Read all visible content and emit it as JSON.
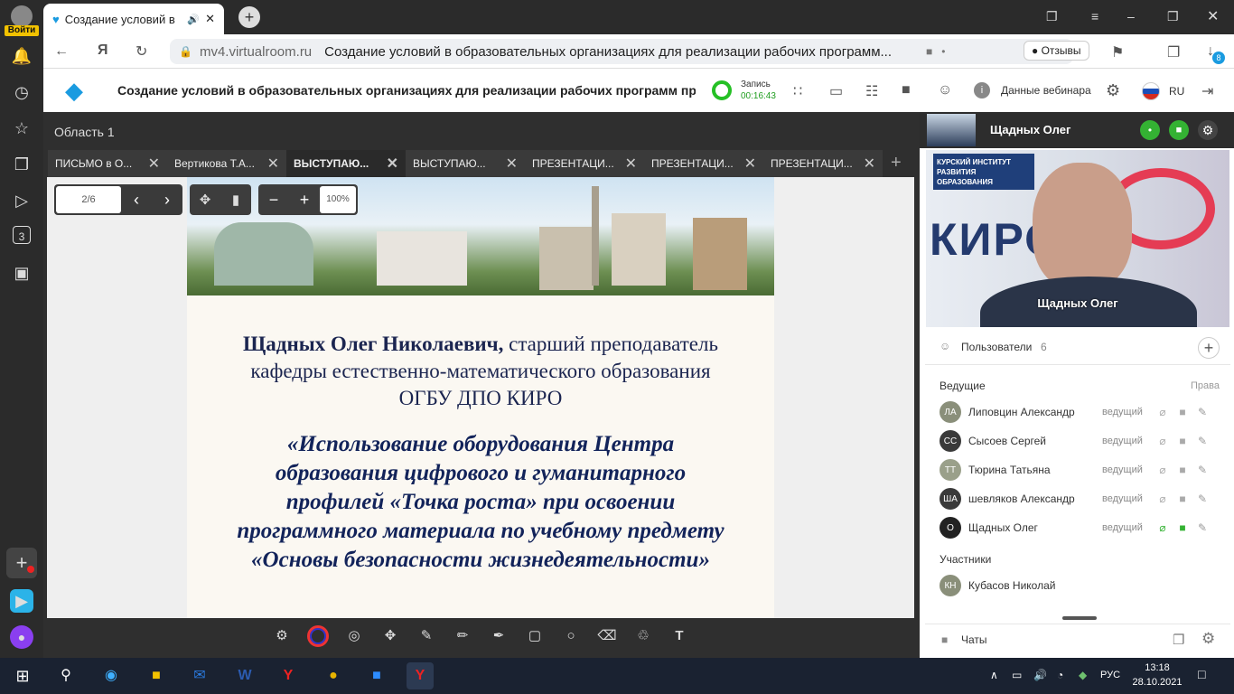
{
  "browser": {
    "login_label": "Войти",
    "sidebar_badge": "3",
    "tab_title": "Создание условий в",
    "url": "mv4.virtualroom.ru",
    "page_title": "Создание условий в образовательных организациях для реализации рабочих программ...",
    "feedback_label": "Отзывы",
    "downloads_badge": "8"
  },
  "app": {
    "title": "Создание условий в образовательных организациях для реализации рабочих программ пре...",
    "record_label": "Запись",
    "record_time": "00:16:43",
    "webinar_data": "Данные вебинара",
    "lang": "RU"
  },
  "area": {
    "title": "Область 1",
    "tabs": [
      "ПИСЬМО в О...",
      "Вертикова Т.А...",
      "ВЫСТУПАЮ...",
      "ВЫСТУПАЮ...",
      "ПРЕЗЕНТАЦИ...",
      "ПРЕЗЕНТАЦИ...",
      "ПРЕЗЕНТАЦИ..."
    ],
    "page_indicator": "2/6",
    "zoom": "100%"
  },
  "slide": {
    "speaker_bold": "Щадных Олег Николаевич,",
    "speaker_rest": " старший преподаватель кафедры естественно-математического образования ОГБУ ДПО КИРО",
    "topic": "«Использование оборудования Центра образования цифрового и гуманитарного профилей «Точка роста» при освоении программного материала по учебному предмету «Основы безопасности жизнедеятельности»"
  },
  "video": {
    "header_name": "Щадных Олег",
    "caption": "Щадных Олег",
    "banner_text": "КУРСКИЙ ИНСТИТУТ РАЗВИТИЯ ОБРАЗОВАНИЯ",
    "wall_text": "КИРО"
  },
  "users": {
    "title": "Пользователи",
    "count": "6",
    "hosts_title": "Ведущие",
    "rights_label": "Права",
    "hosts": [
      {
        "initials": "ЛА",
        "name": "Липовцин Александр",
        "role": "ведущий",
        "color": "#8a8f7a"
      },
      {
        "initials": "СС",
        "name": "Сысоев Сергей",
        "role": "ведущий",
        "color": "#3a3a3a"
      },
      {
        "initials": "ТТ",
        "name": "Тюрина Татьяна",
        "role": "ведущий",
        "color": "#9aa08a"
      },
      {
        "initials": "ША",
        "name": "шевляков Александр",
        "role": "ведущий",
        "color": "#3a3a3a"
      },
      {
        "initials": "О",
        "name": "Щадных Олег",
        "role": "ведущий",
        "color": "#222222"
      }
    ],
    "participants_title": "Участники",
    "participants": [
      {
        "initials": "КН",
        "name": "Кубасов Николай",
        "color": "#8a8f7a"
      }
    ]
  },
  "chats": {
    "title": "Чаты"
  },
  "taskbar": {
    "lang": "РУС",
    "time": "13:18",
    "date": "28.10.2021"
  },
  "colors": {
    "accent": "#1a9be0",
    "green": "#34b233",
    "record": "#25c025"
  }
}
